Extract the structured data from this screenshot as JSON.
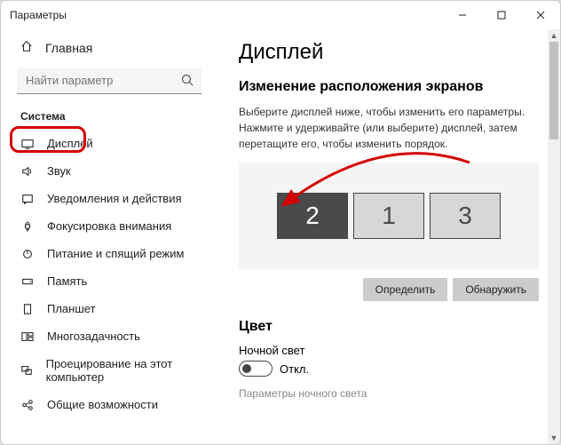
{
  "window": {
    "title": "Параметры"
  },
  "sidebar": {
    "home_label": "Главная",
    "search_placeholder": "Найти параметр",
    "group_label": "Система",
    "items": [
      {
        "label": "Дисплей"
      },
      {
        "label": "Звук"
      },
      {
        "label": "Уведомления и действия"
      },
      {
        "label": "Фокусировка внимания"
      },
      {
        "label": "Питание и спящий режим"
      },
      {
        "label": "Память"
      },
      {
        "label": "Планшет"
      },
      {
        "label": "Многозадачность"
      },
      {
        "label": "Проецирование на этот компьютер"
      },
      {
        "label": "Общие возможности"
      }
    ]
  },
  "content": {
    "title": "Дисплей",
    "rearrange_heading": "Изменение расположения экранов",
    "rearrange_desc": "Выберите дисплей ниже, чтобы изменить его параметры. Нажмите и удерживайте (или выберите) дисплей, затем перетащите его, чтобы изменить порядок.",
    "monitors": [
      {
        "num": "2",
        "selected": true
      },
      {
        "num": "1",
        "selected": false
      },
      {
        "num": "3",
        "selected": false
      }
    ],
    "btn_identify": "Определить",
    "btn_detect": "Обнаружить",
    "color_heading": "Цвет",
    "nightlight_label": "Ночной свет",
    "toggle_state": "Откл.",
    "nightlight_params": "Параметры ночного света"
  }
}
